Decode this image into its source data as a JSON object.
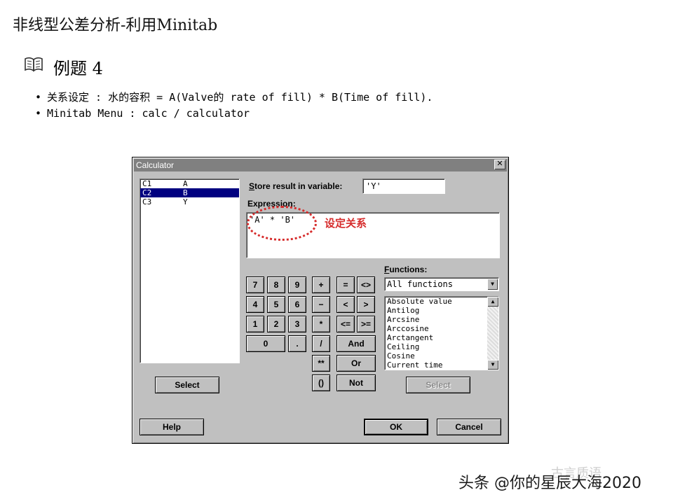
{
  "slide": {
    "title": "非线型公差分析-利用Minitab",
    "section_heading": "例题 4",
    "bullets": [
      "关系设定 : 水的容积  = A(Valve的 rate of fill) * B(Time of fill).",
      "Minitab Menu : calc / calculator"
    ]
  },
  "dialog": {
    "title": "Calculator",
    "close_glyph": "✕",
    "variables": [
      {
        "col": "C1",
        "name": "A",
        "selected": false
      },
      {
        "col": "C2",
        "name": "B",
        "selected": true
      },
      {
        "col": "C3",
        "name": "Y",
        "selected": false
      }
    ],
    "store_label": "Store result in variable:",
    "store_value": "'Y'",
    "expression_label": "Expression:",
    "expression_value": "'A' * 'B'",
    "annotation_text": "设定关系",
    "keypad": {
      "row1": [
        "7",
        "8",
        "9"
      ],
      "row2": [
        "4",
        "5",
        "6"
      ],
      "row3": [
        "1",
        "2",
        "3"
      ],
      "zero": "0",
      "dot": ".",
      "ops": [
        "+",
        "=",
        "<>",
        "−",
        "<",
        ">",
        "*",
        "<=",
        ">=",
        "/",
        "And",
        "**",
        "Or",
        "()",
        "Not"
      ]
    },
    "functions_label": "Functions:",
    "functions_selected": "All functions",
    "functions_list": [
      "Absolute value",
      "Antilog",
      "Arcsine",
      "Arccosine",
      "Arctangent",
      "Ceiling",
      "Cosine",
      "Current time"
    ],
    "select_left_label": "Select",
    "select_right_label": "Select",
    "help_label": "Help",
    "ok_label": "OK",
    "cancel_label": "Cancel"
  },
  "watermark": {
    "main": "头条 @你的星辰大海2020",
    "faint": "古言质语"
  }
}
